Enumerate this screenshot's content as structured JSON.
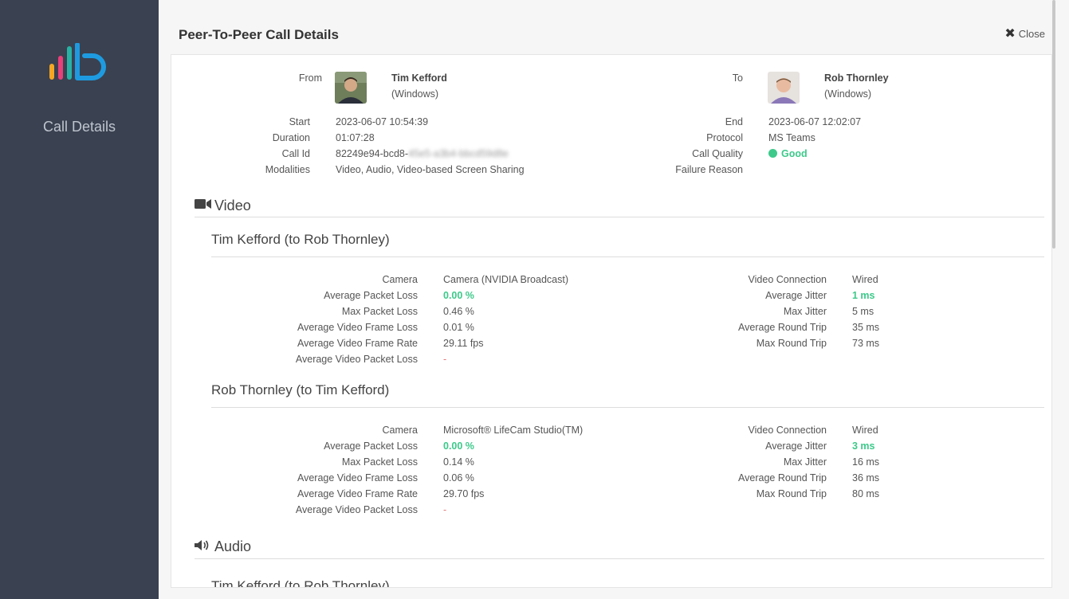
{
  "sidebar": {
    "title": "Call Details",
    "brand_colors": [
      "#f5a623",
      "#e8407a",
      "#26b3a6",
      "#1e9be0"
    ]
  },
  "header": {
    "title": "Peer-To-Peer Call Details",
    "close_label": "Close"
  },
  "call": {
    "from_label": "From",
    "to_label": "To",
    "from": {
      "name": "Tim Kefford",
      "os": "(Windows)"
    },
    "to": {
      "name": "Rob Thornley",
      "os": "(Windows)"
    },
    "start_label": "Start",
    "start": "2023-06-07 10:54:39",
    "duration_label": "Duration",
    "duration": "01:07:28",
    "callid_label": "Call Id",
    "callid": "82249e94-bcd8-",
    "callid_redacted": "45e5-a3b4-bbcd59d8e",
    "modalities_label": "Modalities",
    "modalities": "Video, Audio, Video-based Screen Sharing",
    "end_label": "End",
    "end": "2023-06-07 12:02:07",
    "protocol_label": "Protocol",
    "protocol": "MS Teams",
    "quality_label": "Call Quality",
    "quality": "Good",
    "failure_label": "Failure Reason",
    "failure": ""
  },
  "video": {
    "title": "Video",
    "streams": [
      {
        "title": "Tim Kefford (to Rob Thornley)",
        "left": [
          {
            "label": "Camera",
            "value": "Camera (NVIDIA Broadcast)"
          },
          {
            "label": "Average Packet Loss",
            "value": "0.00 %"
          },
          {
            "label": "Max Packet Loss",
            "value": "0.46 %"
          },
          {
            "label": "Average Video Frame Loss",
            "value": "0.01 %"
          },
          {
            "label": "Average Video Frame Rate",
            "value": "29.11 fps"
          },
          {
            "label": "Average Video Packet Loss",
            "value": "-"
          }
        ],
        "right": [
          {
            "label": "Video Connection",
            "value": "Wired"
          },
          {
            "label": "Average Jitter",
            "value": "1 ms"
          },
          {
            "label": "Max Jitter",
            "value": "5 ms"
          },
          {
            "label": "Average Round Trip",
            "value": "35 ms"
          },
          {
            "label": "Max Round Trip",
            "value": "73 ms"
          }
        ]
      },
      {
        "title": "Rob Thornley (to Tim Kefford)",
        "left": [
          {
            "label": "Camera",
            "value": "Microsoft® LifeCam Studio(TM)"
          },
          {
            "label": "Average Packet Loss",
            "value": "0.00 %"
          },
          {
            "label": "Max Packet Loss",
            "value": "0.14 %"
          },
          {
            "label": "Average Video Frame Loss",
            "value": "0.06 %"
          },
          {
            "label": "Average Video Frame Rate",
            "value": "29.70 fps"
          },
          {
            "label": "Average Video Packet Loss",
            "value": "-"
          }
        ],
        "right": [
          {
            "label": "Video Connection",
            "value": "Wired"
          },
          {
            "label": "Average Jitter",
            "value": "3 ms"
          },
          {
            "label": "Max Jitter",
            "value": "16 ms"
          },
          {
            "label": "Average Round Trip",
            "value": "36 ms"
          },
          {
            "label": "Max Round Trip",
            "value": "80 ms"
          }
        ]
      }
    ]
  },
  "audio": {
    "title": "Audio",
    "first_stream_title": "Tim Kefford (to Rob Thornley)"
  },
  "colors": {
    "good": "#3dc98a",
    "sidebar": "#3a4150"
  }
}
